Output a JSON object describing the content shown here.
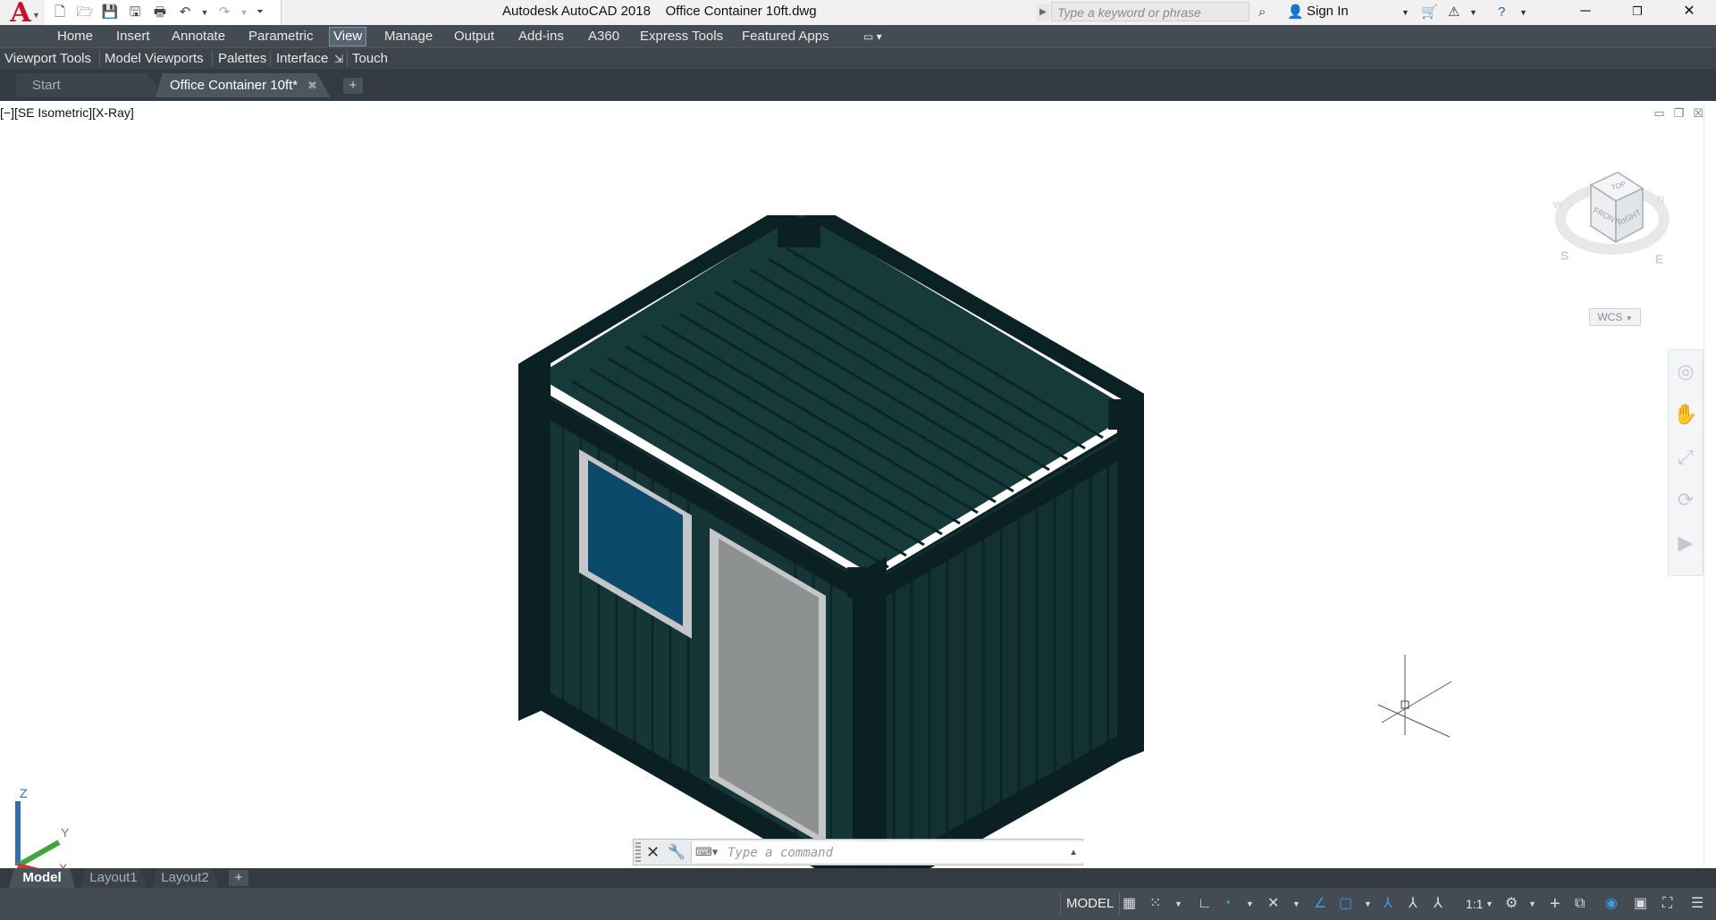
{
  "app": {
    "title": "Autodesk AutoCAD 2018",
    "file": "Office Container 10ft.dwg",
    "logo_letter": "A"
  },
  "qat": {
    "icons": [
      "new-icon",
      "open-icon",
      "save-icon",
      "save-as-icon",
      "plot-icon",
      "undo-icon",
      "undo-dropdown-icon",
      "redo-icon",
      "redo-dropdown-icon",
      "customize-qat-icon"
    ]
  },
  "search": {
    "placeholder": "Type a keyword or phrase"
  },
  "account": {
    "sign_in": "Sign In"
  },
  "ribbon": {
    "tabs": [
      "Home",
      "Insert",
      "Annotate",
      "Parametric",
      "View",
      "Manage",
      "Output",
      "Add-ins",
      "A360",
      "Express Tools",
      "Featured Apps"
    ],
    "active_tab": "View"
  },
  "panels": {
    "items": [
      "Viewport Tools",
      "Model Viewports",
      "Palettes",
      "Interface",
      "Touch"
    ]
  },
  "file_tabs": {
    "start": "Start",
    "doc": "Office Container 10ft*",
    "new": "+"
  },
  "viewport": {
    "label": "[−][SE Isometric][X-Ray]",
    "viewcube": {
      "top": "TOP",
      "front": "FRONT",
      "right": "RIGHT",
      "compass_s": "S",
      "compass_e": "E",
      "compass_n": "N",
      "compass_w": "W"
    },
    "wcs": "WCS",
    "ucs": {
      "x": "X",
      "y": "Y",
      "z": "Z"
    }
  },
  "command": {
    "placeholder": "Type a command"
  },
  "layout_tabs": {
    "items": [
      "Model",
      "Layout1",
      "Layout2"
    ],
    "new": "+"
  },
  "status": {
    "model": "MODEL",
    "scale": "1:1"
  },
  "colors": {
    "ribbon_bg": "#444b52",
    "container_dark": "#0f2a2c",
    "window_glass": "#0b4a6b",
    "door_gray": "#8e9192",
    "accent_blue": "#3a9ae8"
  }
}
